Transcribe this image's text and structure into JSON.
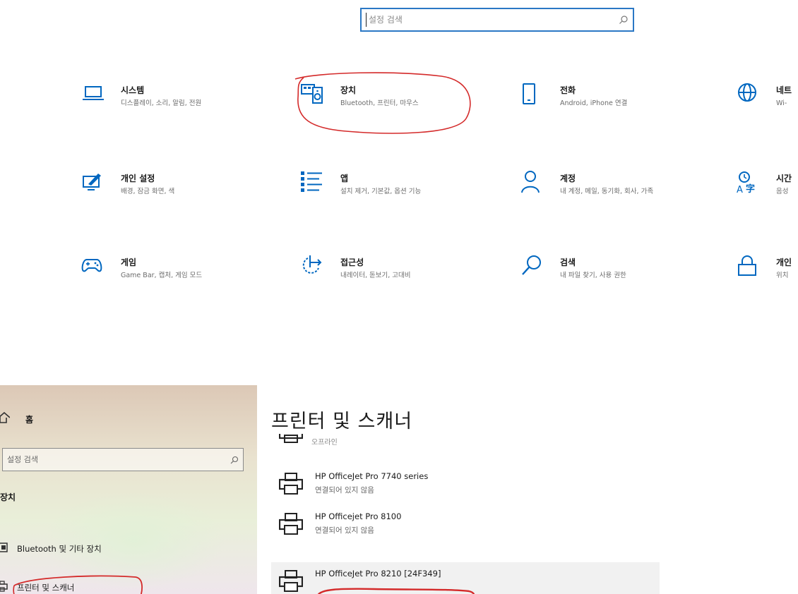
{
  "settings": {
    "search": {
      "placeholder": "설정 검색"
    },
    "tiles": [
      {
        "id": "system",
        "title": "시스템",
        "desc": "디스플레이, 소리, 알림, 전원",
        "icon": "laptop-icon"
      },
      {
        "id": "devices",
        "title": "장치",
        "desc": "Bluetooth, 프린터, 마우스",
        "icon": "devices-icon"
      },
      {
        "id": "phone",
        "title": "전화",
        "desc": "Android, iPhone 연결",
        "icon": "phone-icon"
      },
      {
        "id": "network",
        "title": "네트",
        "desc": "Wi-",
        "icon": "globe-icon"
      },
      {
        "id": "personalization",
        "title": "개인 설정",
        "desc": "배경, 잠금 화면, 색",
        "icon": "personalization-icon"
      },
      {
        "id": "apps",
        "title": "앱",
        "desc": "설치 제거, 기본값, 옵션 기능",
        "icon": "apps-list-icon"
      },
      {
        "id": "accounts",
        "title": "계정",
        "desc": "내 계정, 메일, 동기화, 회사, 가족",
        "icon": "person-icon"
      },
      {
        "id": "time-language",
        "title": "시간",
        "desc": "음성",
        "icon": "time-language-icon"
      },
      {
        "id": "gaming",
        "title": "게임",
        "desc": "Game Bar, 캡처, 게임 모드",
        "icon": "gamepad-icon"
      },
      {
        "id": "accessibility",
        "title": "접근성",
        "desc": "내레이터, 돋보기, 고대비",
        "icon": "accessibility-icon"
      },
      {
        "id": "search",
        "title": "검색",
        "desc": "내 파일 찾기, 사용 권한",
        "icon": "search-icon"
      },
      {
        "id": "privacy",
        "title": "개인",
        "desc": "위치",
        "icon": "lock-icon"
      }
    ],
    "accent_color": "#0067c0"
  },
  "sidebar": {
    "home": "홈",
    "search_placeholder": "설정 검색",
    "section": "장치",
    "items": [
      {
        "label": "Bluetooth 및 기타 장치"
      },
      {
        "label": "프린터 및 스캐너"
      }
    ]
  },
  "printers": {
    "title": "프린터 및 스캐너",
    "partial_label": "오프라인",
    "list": [
      {
        "name": "HP OfficeJet Pro 7740 series",
        "status": "연결되어 있지 않음"
      },
      {
        "name": "HP Officejet Pro 8100",
        "status": "연결되어 있지 않음"
      },
      {
        "name": "HP OfficeJet Pro 8210 [24F349]",
        "status": ""
      }
    ]
  },
  "annotation_color": "#d42a2a"
}
